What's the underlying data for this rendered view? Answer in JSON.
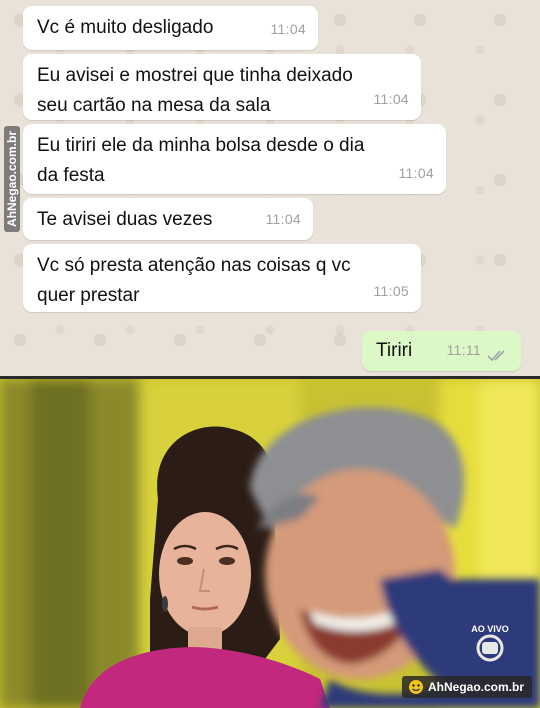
{
  "messages": [
    {
      "direction": "incoming",
      "text": "Vc é muito desligado",
      "time": "11:04"
    },
    {
      "direction": "incoming",
      "text": "Eu avisei e mostrei que tinha deixado\nseu cartão na mesa da sala",
      "time": "11:04"
    },
    {
      "direction": "incoming",
      "text": "Eu tiriri ele da minha bolsa desde o dia\nda festa",
      "time": "11:04"
    },
    {
      "direction": "incoming",
      "text": "Te avisei duas vezes",
      "time": "11:04"
    },
    {
      "direction": "incoming",
      "text": "Vc só presta atenção nas coisas q vc\nquer prestar",
      "time": "11:05"
    },
    {
      "direction": "outgoing",
      "text": "Tiriri",
      "time": "11:11",
      "status": "read"
    }
  ],
  "watermark": {
    "side_text": "AhNegao.com.br",
    "badge_text": "AhNegao.com.br"
  },
  "photo": {
    "broadcast_label": "AO VIVO"
  },
  "colors": {
    "incoming_bubble": "#ffffff",
    "outgoing_bubble": "#dcf8c6",
    "chat_background": "#e9e2d8",
    "read_ticks": "#9aa3a8"
  }
}
